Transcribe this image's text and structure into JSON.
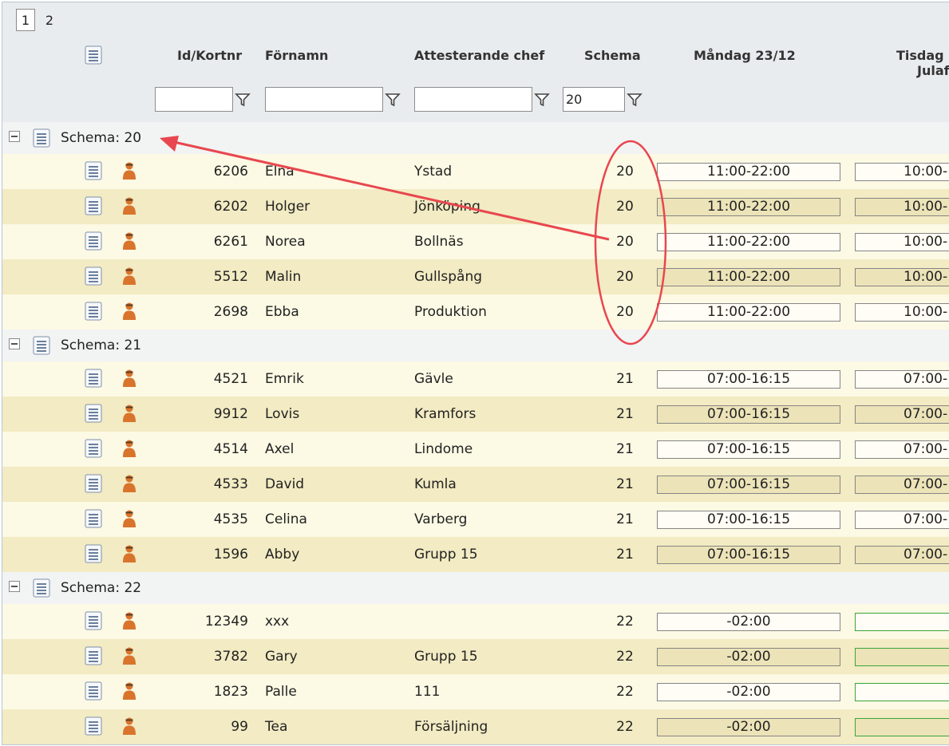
{
  "pager": {
    "pages": [
      "1",
      "2"
    ],
    "active": "1"
  },
  "columns": {
    "id": "Id/Kortnr",
    "first_name": "Förnamn",
    "manager": "Attesterande chef",
    "schedule": "Schema",
    "monday": "Måndag  23/12",
    "tuesday": "Tisdag",
    "tuesday_sub": "Julaf"
  },
  "filters": {
    "id": "",
    "first_name": "",
    "manager": "",
    "schedule": "20"
  },
  "groups": [
    {
      "label": "Schema: 20",
      "rows": [
        {
          "id": "6206",
          "name": "Elna",
          "chef": "Ystad",
          "sch": "20",
          "mon": "11:00-22:00",
          "tue": "10:00-"
        },
        {
          "id": "6202",
          "name": "Holger",
          "chef": "Jönköping",
          "sch": "20",
          "mon": "11:00-22:00",
          "tue": "10:00-"
        },
        {
          "id": "6261",
          "name": "Norea",
          "chef": "Bollnäs",
          "sch": "20",
          "mon": "11:00-22:00",
          "tue": "10:00-"
        },
        {
          "id": "5512",
          "name": "Malin",
          "chef": "Gullspång",
          "sch": "20",
          "mon": "11:00-22:00",
          "tue": "10:00-"
        },
        {
          "id": "2698",
          "name": "Ebba",
          "chef": "Produktion",
          "sch": "20",
          "mon": "11:00-22:00",
          "tue": "10:00-"
        }
      ]
    },
    {
      "label": "Schema: 21",
      "rows": [
        {
          "id": "4521",
          "name": "Emrik",
          "chef": "Gävle",
          "sch": "21",
          "mon": "07:00-16:15",
          "tue": "07:00-"
        },
        {
          "id": "9912",
          "name": "Lovis",
          "chef": "Kramfors",
          "sch": "21",
          "mon": "07:00-16:15",
          "tue": "07:00-"
        },
        {
          "id": "4514",
          "name": "Axel",
          "chef": "Lindome",
          "sch": "21",
          "mon": "07:00-16:15",
          "tue": "07:00-"
        },
        {
          "id": "4533",
          "name": "David",
          "chef": "Kumla",
          "sch": "21",
          "mon": "07:00-16:15",
          "tue": "07:00-"
        },
        {
          "id": "4535",
          "name": "Celina",
          "chef": "Varberg",
          "sch": "21",
          "mon": "07:00-16:15",
          "tue": "07:00-"
        },
        {
          "id": "1596",
          "name": "Abby",
          "chef": "Grupp 15",
          "sch": "21",
          "mon": "07:00-16:15",
          "tue": "07:00-"
        }
      ]
    },
    {
      "label": "Schema: 22",
      "rows": [
        {
          "id": "12349",
          "name": "xxx",
          "chef": "",
          "sch": "22",
          "mon": "-02:00",
          "tue": "",
          "tue_green": true
        },
        {
          "id": "3782",
          "name": "Gary",
          "chef": "Grupp 15",
          "sch": "22",
          "mon": "-02:00",
          "tue": "",
          "tue_green": true
        },
        {
          "id": "1823",
          "name": "Palle",
          "chef": "111",
          "sch": "22",
          "mon": "-02:00",
          "tue": "",
          "tue_green": true
        },
        {
          "id": "99",
          "name": "Tea",
          "chef": "Försäljning",
          "sch": "22",
          "mon": "-02:00",
          "tue": "",
          "tue_green": true
        }
      ]
    }
  ],
  "annotation": {
    "color": "#e8474f"
  },
  "colors": {
    "header_bg": "#e9ecee",
    "row_odd": "#fcf9e4",
    "row_even": "#f2ebc3",
    "group_bg": "#f2f3f3",
    "person_icon": "#d9742c"
  }
}
